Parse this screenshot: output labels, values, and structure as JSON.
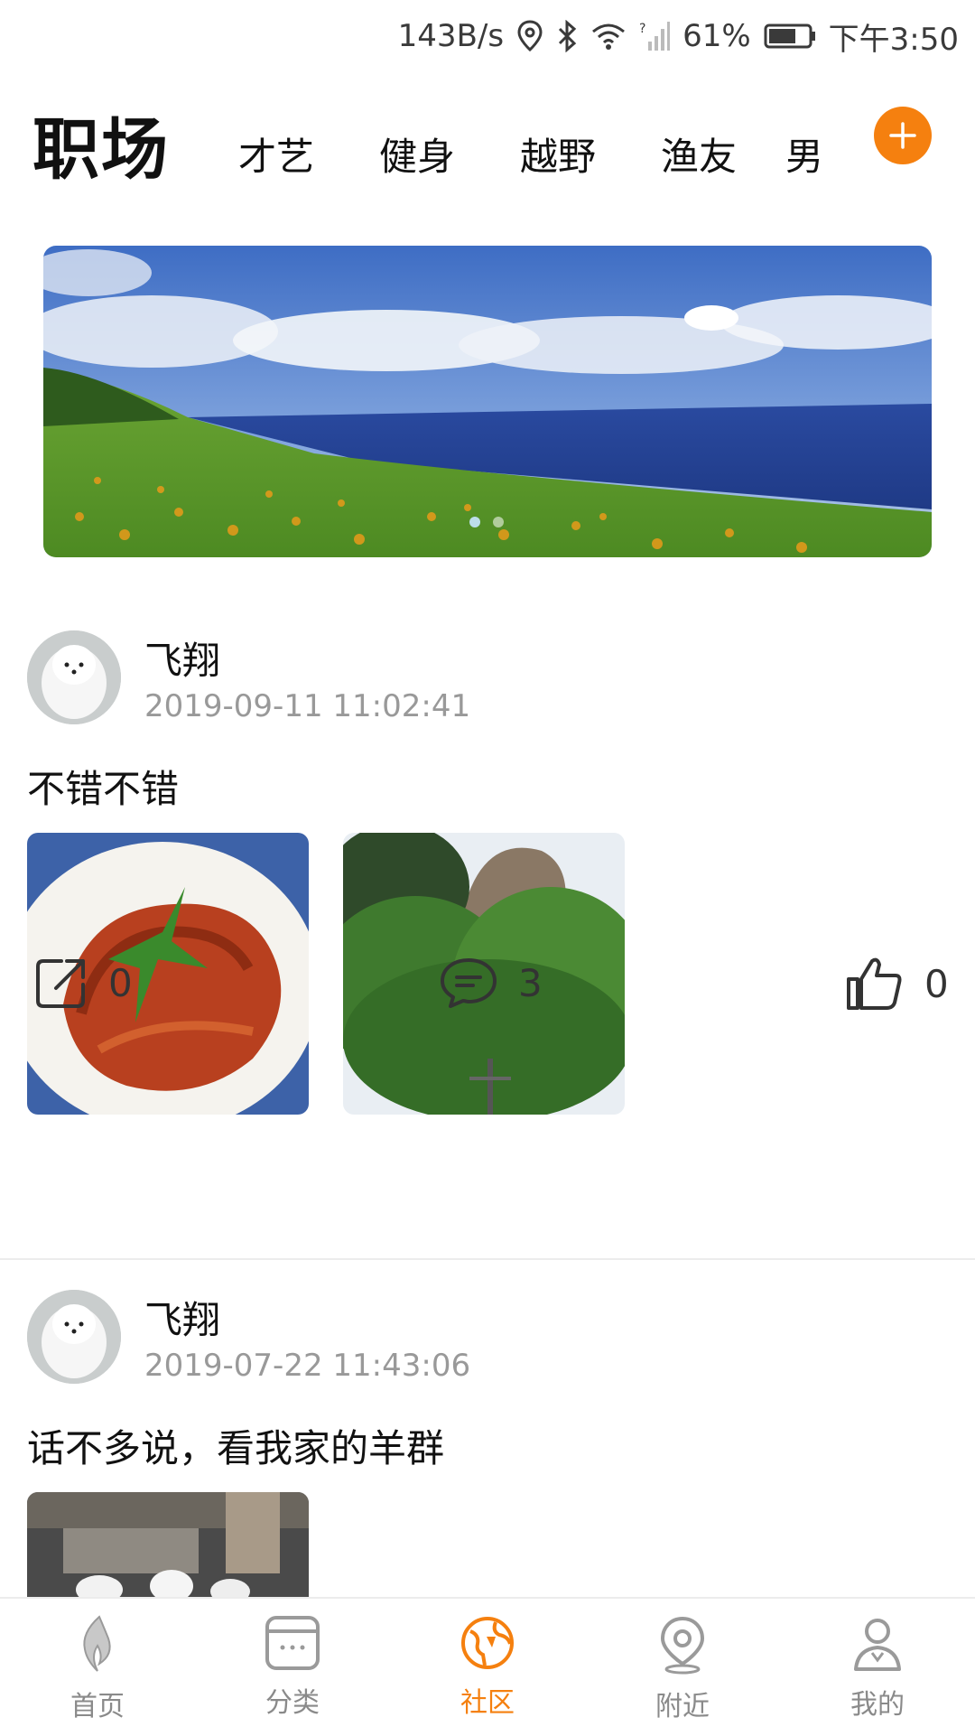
{
  "status_bar": {
    "net_speed": "143B/s",
    "battery": "61%",
    "time": "下午3:50"
  },
  "tabs": {
    "active": "职场",
    "items": [
      "才艺",
      "健身",
      "越野",
      "渔友",
      "男"
    ],
    "add_icon": "plus-icon"
  },
  "banner": {
    "dots_count": 2,
    "active_dot": 1
  },
  "posts": [
    {
      "author": "飞翔",
      "time": "2019-09-11 11:02:41",
      "content": "不错不错",
      "shares": "0",
      "comments": "3",
      "likes": "0"
    },
    {
      "author": "飞翔",
      "time": "2019-07-22 11:43:06",
      "content": "话不多说，看我家的羊群"
    }
  ],
  "bottom_nav": {
    "items": [
      {
        "label": "首页",
        "icon": "flame-icon"
      },
      {
        "label": "分类",
        "icon": "category-icon"
      },
      {
        "label": "社区",
        "icon": "community-icon"
      },
      {
        "label": "附近",
        "icon": "location-icon"
      },
      {
        "label": "我的",
        "icon": "profile-icon"
      }
    ],
    "active_index": 2
  },
  "colors": {
    "accent": "#f5800f",
    "muted": "#999999"
  }
}
